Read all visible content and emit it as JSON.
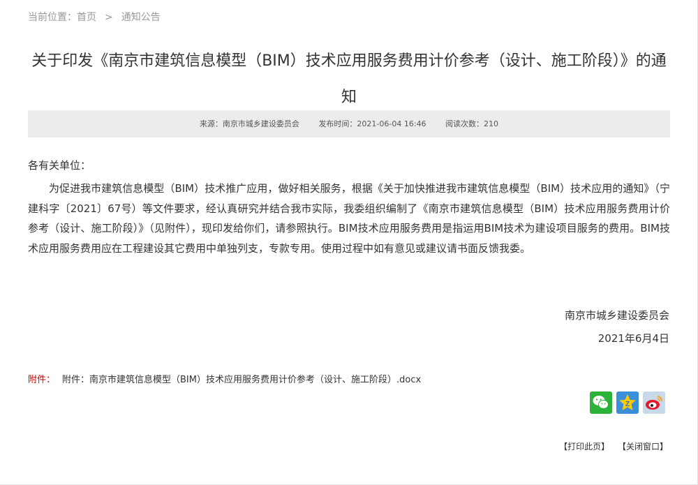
{
  "breadcrumb": {
    "prefix": "当前位置：",
    "home": "首页",
    "separator": ">",
    "current": "通知公告"
  },
  "article": {
    "title": "关于印发《南京市建筑信息模型（BIM）技术应用服务费用计价参考（设计、施工阶段）》的通知",
    "meta": {
      "source": "来源：南京市城乡建设委员会",
      "date": "发布时间：2021-06-04 16:46",
      "views": "阅读次数：210"
    },
    "salutation": "各有关单位：",
    "body": "为促进我市建筑信息模型（BIM）技术推广应用，做好相关服务，根据《关于加快推进我市建筑信息模型（BIM）技术应用的通知》（宁建科字〔2021〕67号）等文件要求，经认真研究并结合我市实际，我委组织编制了《南京市建筑信息模型（BIM）技术应用服务费用计价参考（设计、施工阶段）》（见附件），现印发给你们，请参照执行。BIM技术应用服务费用是指运用BIM技术为建设项目服务的费用。BIM技术应用服务费用应在工程建设其它费用中单独列支，专款专用。使用过程中如有意见或建议请书面反馈我委。",
    "signature": "南京市城乡建设委员会",
    "sign_date": "2021年6月4日"
  },
  "attachment": {
    "label": "附件：",
    "file": "附件：南京市建筑信息模型（BIM）技术应用服务费用计价参考（设计、施工阶段）.docx"
  },
  "share": {
    "icons": [
      "wechat-icon",
      "qzone-icon",
      "weibo-icon"
    ],
    "colors": {
      "wechat": "#2ab338",
      "qzone": "#3b8ed8",
      "weibo": "#c8d9e9"
    }
  },
  "actions": {
    "print": "【打印此页】",
    "close": "【关闭窗口】"
  }
}
